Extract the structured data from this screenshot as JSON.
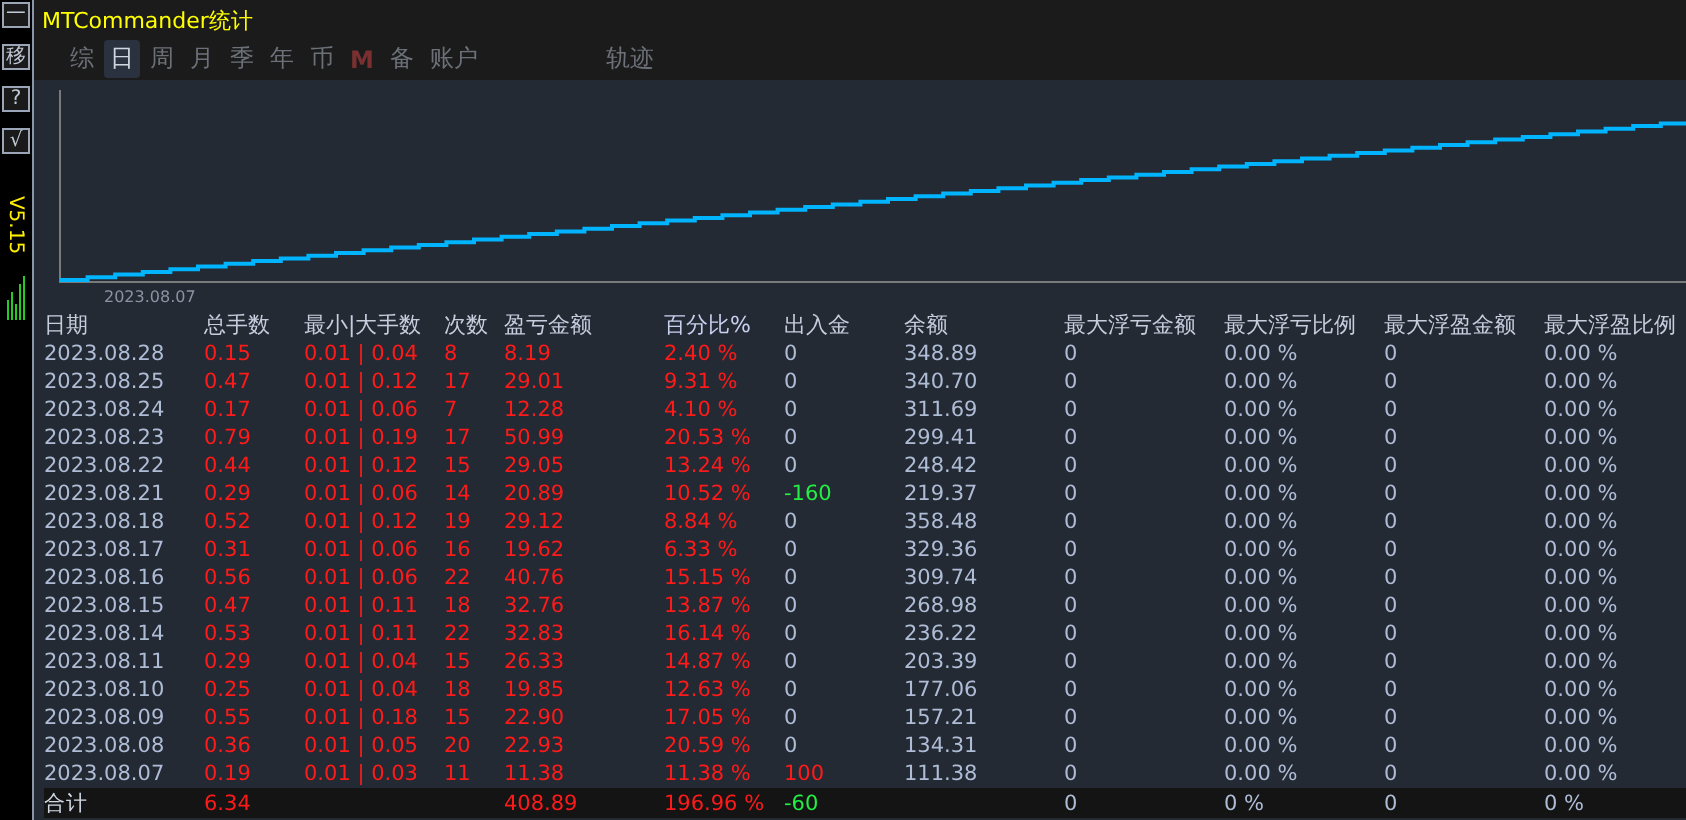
{
  "sidebar": {
    "buttons": [
      "一",
      "移",
      "?",
      "√"
    ],
    "version": "V5.15"
  },
  "window": {
    "title": "MTCommander统计"
  },
  "tabs": [
    {
      "label": "综",
      "selected": false,
      "kind": "text"
    },
    {
      "label": "日",
      "selected": true,
      "kind": "text"
    },
    {
      "label": "周",
      "selected": false,
      "kind": "text"
    },
    {
      "label": "月",
      "selected": false,
      "kind": "text"
    },
    {
      "label": "季",
      "selected": false,
      "kind": "text"
    },
    {
      "label": "年",
      "selected": false,
      "kind": "text"
    },
    {
      "label": "币",
      "selected": false,
      "kind": "text"
    },
    {
      "label": "M",
      "selected": false,
      "kind": "mark"
    },
    {
      "label": "备",
      "selected": false,
      "kind": "text"
    },
    {
      "label": "账户",
      "selected": false,
      "kind": "text"
    },
    {
      "label": "轨迹",
      "selected": false,
      "kind": "far"
    }
  ],
  "chart": {
    "start_label": "2023.08.07"
  },
  "table": {
    "columns": [
      "日期",
      "总手数",
      "最小|大手数",
      "次数",
      "盈亏金额",
      "百分比%",
      "出入金",
      "余额",
      "最大浮亏金额",
      "最大浮亏比例",
      "最大浮盈金额",
      "最大浮盈比例"
    ],
    "rows": [
      {
        "cells": [
          "2023.08.28",
          "0.15",
          "0.01 | 0.04",
          "8",
          "8.19",
          "2.40 %",
          "0",
          "348.89",
          "0",
          "0.00 %",
          "0",
          "0.00 %"
        ],
        "kind": "none"
      },
      {
        "cells": [
          "2023.08.25",
          "0.47",
          "0.01 | 0.12",
          "17",
          "29.01",
          "9.31 %",
          "0",
          "340.70",
          "0",
          "0.00 %",
          "0",
          "0.00 %"
        ],
        "kind": "none"
      },
      {
        "cells": [
          "2023.08.24",
          "0.17",
          "0.01 | 0.06",
          "7",
          "12.28",
          "4.10 %",
          "0",
          "311.69",
          "0",
          "0.00 %",
          "0",
          "0.00 %"
        ],
        "kind": "none"
      },
      {
        "cells": [
          "2023.08.23",
          "0.79",
          "0.01 | 0.19",
          "17",
          "50.99",
          "20.53 %",
          "0",
          "299.41",
          "0",
          "0.00 %",
          "0",
          "0.00 %"
        ],
        "kind": "none"
      },
      {
        "cells": [
          "2023.08.22",
          "0.44",
          "0.01 | 0.12",
          "15",
          "29.05",
          "13.24 %",
          "0",
          "248.42",
          "0",
          "0.00 %",
          "0",
          "0.00 %"
        ],
        "kind": "none"
      },
      {
        "cells": [
          "2023.08.21",
          "0.29",
          "0.01 | 0.06",
          "14",
          "20.89",
          "10.52 %",
          "-160",
          "219.37",
          "0",
          "0.00 %",
          "0",
          "0.00 %"
        ],
        "kind": "withdrawal"
      },
      {
        "cells": [
          "2023.08.18",
          "0.52",
          "0.01 | 0.12",
          "19",
          "29.12",
          "8.84 %",
          "0",
          "358.48",
          "0",
          "0.00 %",
          "0",
          "0.00 %"
        ],
        "kind": "none"
      },
      {
        "cells": [
          "2023.08.17",
          "0.31",
          "0.01 | 0.06",
          "16",
          "19.62",
          "6.33 %",
          "0",
          "329.36",
          "0",
          "0.00 %",
          "0",
          "0.00 %"
        ],
        "kind": "none"
      },
      {
        "cells": [
          "2023.08.16",
          "0.56",
          "0.01 | 0.06",
          "22",
          "40.76",
          "15.15 %",
          "0",
          "309.74",
          "0",
          "0.00 %",
          "0",
          "0.00 %"
        ],
        "kind": "none"
      },
      {
        "cells": [
          "2023.08.15",
          "0.47",
          "0.01 | 0.11",
          "18",
          "32.76",
          "13.87 %",
          "0",
          "268.98",
          "0",
          "0.00 %",
          "0",
          "0.00 %"
        ],
        "kind": "none"
      },
      {
        "cells": [
          "2023.08.14",
          "0.53",
          "0.01 | 0.11",
          "22",
          "32.83",
          "16.14 %",
          "0",
          "236.22",
          "0",
          "0.00 %",
          "0",
          "0.00 %"
        ],
        "kind": "none"
      },
      {
        "cells": [
          "2023.08.11",
          "0.29",
          "0.01 | 0.04",
          "15",
          "26.33",
          "14.87 %",
          "0",
          "203.39",
          "0",
          "0.00 %",
          "0",
          "0.00 %"
        ],
        "kind": "none"
      },
      {
        "cells": [
          "2023.08.10",
          "0.25",
          "0.01 | 0.04",
          "18",
          "19.85",
          "12.63 %",
          "0",
          "177.06",
          "0",
          "0.00 %",
          "0",
          "0.00 %"
        ],
        "kind": "none"
      },
      {
        "cells": [
          "2023.08.09",
          "0.55",
          "0.01 | 0.18",
          "15",
          "22.90",
          "17.05 %",
          "0",
          "157.21",
          "0",
          "0.00 %",
          "0",
          "0.00 %"
        ],
        "kind": "none"
      },
      {
        "cells": [
          "2023.08.08",
          "0.36",
          "0.01 | 0.05",
          "20",
          "22.93",
          "20.59 %",
          "0",
          "134.31",
          "0",
          "0.00 %",
          "0",
          "0.00 %"
        ],
        "kind": "none"
      },
      {
        "cells": [
          "2023.08.07",
          "0.19",
          "0.01 | 0.03",
          "11",
          "11.38",
          "11.38 %",
          "100",
          "111.38",
          "0",
          "0.00 %",
          "0",
          "0.00 %"
        ],
        "kind": "deposit"
      }
    ],
    "total": {
      "cells": [
        "合计",
        "6.34",
        null,
        null,
        "408.89",
        "196.96 %",
        "-60",
        null,
        "0",
        "0 %",
        "0",
        "0 %"
      ],
      "kind": "withdrawal"
    }
  }
}
